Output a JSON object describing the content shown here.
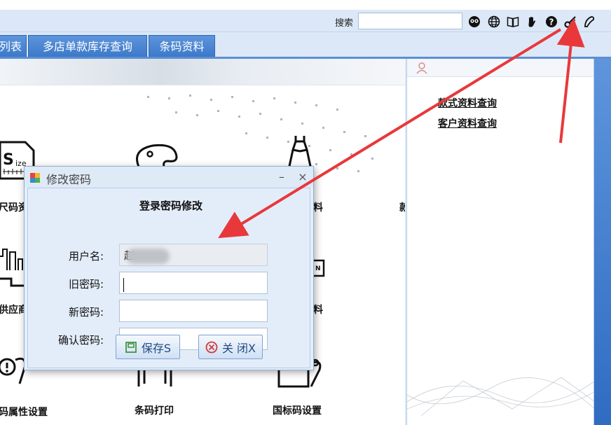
{
  "toolbar": {
    "search_label": "搜索",
    "search_value": ""
  },
  "tabs": [
    {
      "label": "列表"
    },
    {
      "label": "多店单款库存查询"
    },
    {
      "label": "条码资料"
    }
  ],
  "side_panel": {
    "links": [
      "款式资料查询",
      "客户资料查询"
    ]
  },
  "modules": {
    "size": "尺码资",
    "supplier": "供应商",
    "attr": "码属性设置",
    "barcode_print": "条码打印",
    "intl_code": "国标码设置",
    "item_a": "料",
    "item_b": "料",
    "right_cut": "款"
  },
  "dialog": {
    "title": "修改密码",
    "heading": "登录密码修改",
    "username_label": "用户名:",
    "username_value": "赵",
    "old_pw_label": "旧密码:",
    "new_pw_label": "新密码:",
    "confirm_pw_label": "确认密码:",
    "save_label": "保存S",
    "close_label": "关 闭X"
  },
  "colors": {
    "tab": "#4a86d3",
    "arrow": "#e8383b",
    "panel_bg": "#dce8f7"
  }
}
